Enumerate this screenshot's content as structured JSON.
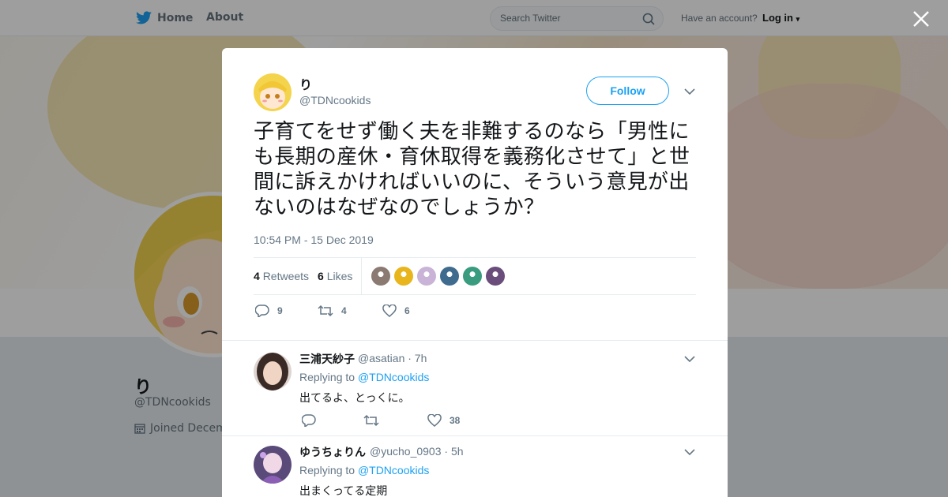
{
  "nav": {
    "home_label": "Home",
    "about_label": "About",
    "search_placeholder": "Search Twitter",
    "have_account": "Have an account?",
    "login_label": "Log in"
  },
  "profile_bg": {
    "name": "り",
    "handle": "@TDNcookids",
    "joined": "Joined Decem"
  },
  "tweet": {
    "author_name": "り",
    "author_handle": "@TDNcookids",
    "follow_label": "Follow",
    "text": "子育てをせず働く夫を非難するのなら「男性にも長期の産休・育休取得を義務化させて」と世間に訴えかければいいのに、そういう意見が出ないのはなぜなのでしょうか？",
    "timestamp": "10:54 PM - 15 Dec 2019",
    "retweets_count": "4",
    "retweets_label": "Retweets",
    "likes_count": "6",
    "likes_label": "Likes",
    "reply_count": "9",
    "retweet_count": "4",
    "like_count": "6",
    "likers": [
      "#8a7a72",
      "#e8b51c",
      "#c9b3d6",
      "#3f6b8f",
      "#3a9c7e",
      "#6a4d7a"
    ]
  },
  "replies": [
    {
      "name": "三浦天紗子",
      "handle": "@asatian",
      "time": "· 7h",
      "replying_prefix": "Replying to",
      "replying_to": "@TDNcookids",
      "text": "出てるよ、とっくに。",
      "like_count": "38"
    },
    {
      "name": "ゆうちょりん",
      "handle": "@yucho_0903",
      "time": "· 5h",
      "replying_prefix": "Replying to",
      "replying_to": "@TDNcookids",
      "text": "出まくってる定期"
    }
  ],
  "colors": {
    "accent": "#1da1f2",
    "secondary_text": "#657786"
  }
}
